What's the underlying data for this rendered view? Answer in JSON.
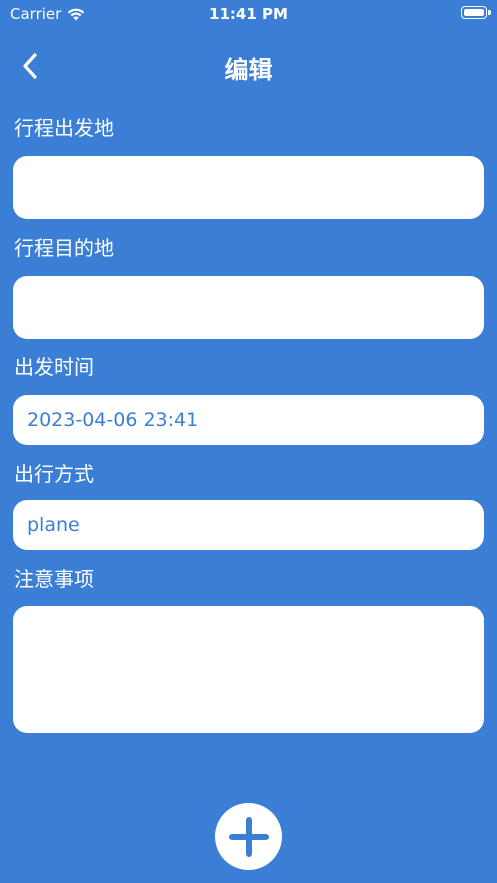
{
  "status_bar": {
    "carrier": "Carrier",
    "time": "11:41 PM"
  },
  "nav": {
    "title": "编辑"
  },
  "form": {
    "departure": {
      "label": "行程出发地",
      "value": ""
    },
    "destination": {
      "label": "行程目的地",
      "value": ""
    },
    "departure_time": {
      "label": "出发时间",
      "value": "2023-04-06 23:41"
    },
    "travel_mode": {
      "label": "出行方式",
      "value": "plane"
    },
    "notes": {
      "label": "注意事项",
      "value": ""
    }
  },
  "colors": {
    "background": "#3a7fd5",
    "field_background": "#ffffff",
    "field_text": "#3a7fd5",
    "label_text": "#ffffff"
  },
  "icons": {
    "back": "chevron-left-icon",
    "add": "plus-icon",
    "wifi": "wifi-icon",
    "battery": "battery-icon"
  }
}
